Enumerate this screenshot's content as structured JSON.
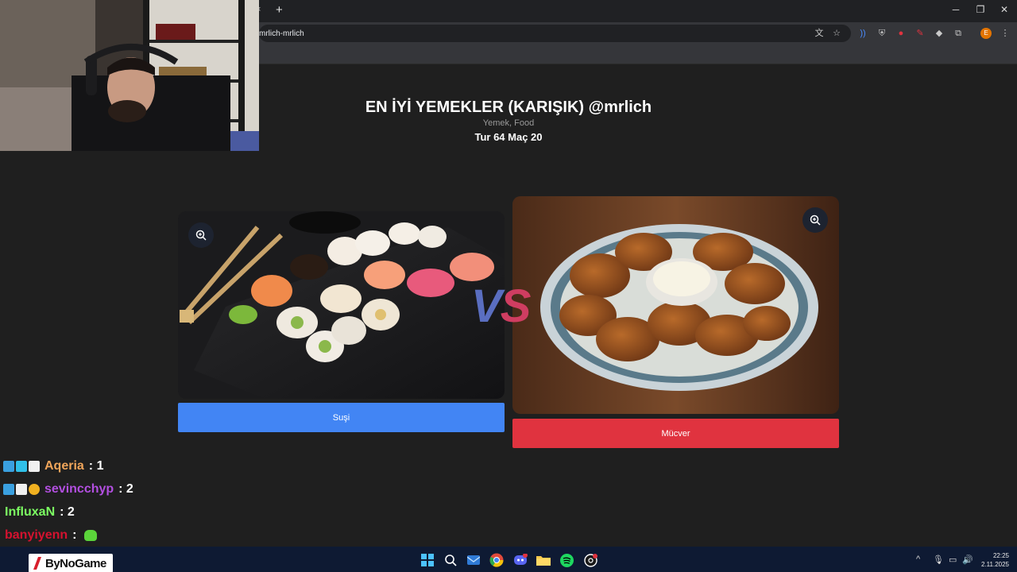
{
  "browser": {
    "url_fragment": "mrlich-mrlich",
    "tab_close": "×",
    "new_tab": "+",
    "profile_initial": "E"
  },
  "page": {
    "title": "EN İYİ YEMEKLER (KARIŞIK) @mrlich",
    "subtitle": "Yemek, Food",
    "round": "Tur 64 Maç 20",
    "vs_v": "V",
    "vs_s": "S"
  },
  "choices": {
    "left_label": "Suşi",
    "right_label": "Mücver"
  },
  "chat": [
    {
      "user": "Aqeria",
      "msg": ": 1",
      "color": "#f0a55a"
    },
    {
      "user": "sevincchyp",
      "msg": ": 2",
      "color": "#b24fe0"
    },
    {
      "user": "InfluxaN",
      "msg": ": 2",
      "color": "#7cff62"
    },
    {
      "user": "banyiyenn",
      "msg": ":",
      "color": "#d5122f"
    }
  ],
  "taskbar": {
    "logo": "ByNoGame",
    "time": "22:25",
    "date": "2.11.2025"
  },
  "colors": {
    "left_button": "#4285f4",
    "right_button": "#e0333f"
  }
}
